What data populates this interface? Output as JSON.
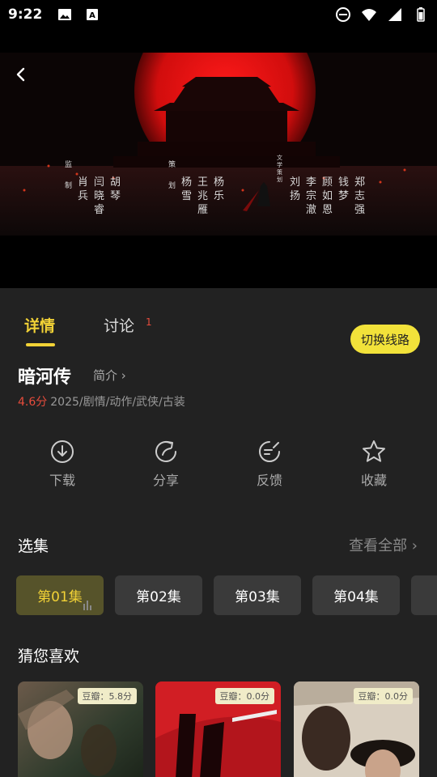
{
  "status_bar": {
    "time": "9:22",
    "left_icons": [
      "image-icon",
      "text-a-icon"
    ],
    "right_icons": [
      "do-not-disturb-icon",
      "wifi-icon",
      "signal-icon",
      "battery-icon"
    ]
  },
  "player": {
    "back_icon": "chevron-left-icon",
    "credits": {
      "group1": {
        "role": "监制",
        "names": [
          "肖兵",
          "闫晓睿",
          "胡琴"
        ]
      },
      "group2": {
        "role": "策划",
        "names": [
          "杨雪",
          "王兆雁",
          "杨乐"
        ]
      },
      "group3": {
        "role": "文学策划",
        "names": [
          "刘扬",
          "李宗澈",
          "顾如恩",
          "钱梦",
          "郑志强"
        ]
      }
    }
  },
  "tabs": {
    "detail": "详情",
    "discuss": "讨论",
    "discuss_count": "1",
    "switch_line": "切换线路"
  },
  "show": {
    "title": "暗河传",
    "intro": "简介",
    "score": "4.6分",
    "info": "2025/剧情/动作/武侠/古装"
  },
  "actions": [
    {
      "icon": "download-icon",
      "label": "下载"
    },
    {
      "icon": "share-icon",
      "label": "分享"
    },
    {
      "icon": "feedback-icon",
      "label": "反馈"
    },
    {
      "icon": "star-icon",
      "label": "收藏"
    }
  ],
  "episodes_section": {
    "title": "选集",
    "view_all": "查看全部",
    "items": [
      "第01集",
      "第02集",
      "第03集",
      "第04集"
    ],
    "selected_index": 0
  },
  "recommend_section": {
    "title": "猜您喜欢",
    "items": [
      {
        "score": "豆瓣：5.8分"
      },
      {
        "score": "豆瓣：0.0分"
      },
      {
        "score": "豆瓣：0.0分"
      }
    ]
  },
  "colors": {
    "accent": "#f2d236",
    "panel_bg": "#222222",
    "score_red": "#e74c3c"
  }
}
